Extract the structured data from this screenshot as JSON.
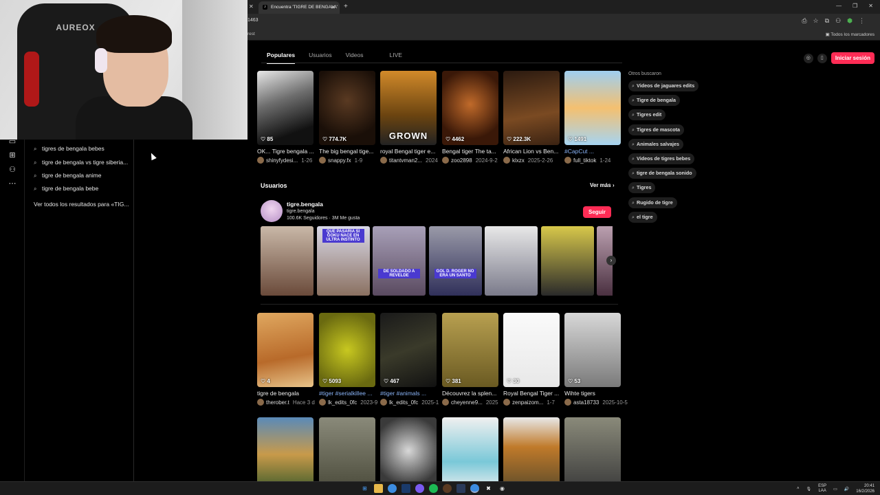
{
  "webcam": {
    "chair_logo": "AUREOX"
  },
  "browser": {
    "tab_title": "Encuentra 'TIGRE DE BENGALA'",
    "url": "1463",
    "bookmark_left": "rest",
    "bookmark_right": "Todos los marcadores"
  },
  "suggestions": {
    "items": [
      "tigres de bengala bebes",
      "tigre de bengala vs tigre siberia...",
      "tigre de bengala anime",
      "tigre de bengala bebe"
    ],
    "see_all": "Ver todos los resultados para «TIG..."
  },
  "search_tabs": [
    "Populares",
    "Usuarios",
    "Videos",
    "LIVE"
  ],
  "header": {
    "login": "Iniciar sesión"
  },
  "row1": [
    {
      "likes": "85",
      "title": "OK... Tigre bengala ...",
      "user": "shinyfydesi...",
      "date": "1-26",
      "blue": false,
      "bg": "linear-gradient(160deg,#e8e8e8,#6d6d6d 40%,#111 80%)"
    },
    {
      "likes": "774.7K",
      "title": "The big bengal tige...",
      "user": "snappy.fx",
      "date": "1-9",
      "blue": false,
      "bg": "radial-gradient(circle at 50% 40%,#5a3a22,#1a0f08 70%)"
    },
    {
      "likes": "",
      "title": "royal Bengal tiger e...",
      "user": "titantvman2...",
      "date": "2024",
      "blue": false,
      "bg": "linear-gradient(180deg,#d28a2a,#6b4410 60%,#222 100%)",
      "overlay": "GROWN"
    },
    {
      "likes": "4462",
      "title": "Bengal tiger The ta...",
      "user": "zoo2898",
      "date": "2024-9-2",
      "blue": false,
      "bg": "radial-gradient(circle at 50% 45%,#c06a2a,#3a1808 70%)"
    },
    {
      "likes": "222.3K",
      "title": "African Lion vs Ben...",
      "user": "klxzx",
      "date": "2025-2-26",
      "blue": false,
      "bg": "linear-gradient(170deg,#2b1a10,#7a4a22 60%,#3a2212)"
    },
    {
      "likes": "1491",
      "title": "#CapCut ...",
      "user": "full_tiktok",
      "date": "1-24",
      "blue": true,
      "bg": "linear-gradient(180deg,#9fcff0,#f4c070 50%,#a6d4f2)"
    }
  ],
  "users_section": {
    "title": "Usuarios",
    "see_more": "Ver más"
  },
  "user": {
    "name": "tigre.bengala",
    "handle": "tigre.bengala",
    "followers": "100.6K",
    "followers_label": "Seguidores",
    "likes": "3M",
    "likes_label": "Me gusta",
    "follow": "Seguir"
  },
  "user_thumbs": [
    {
      "caption": "",
      "bg": "linear-gradient(180deg,#c9b8a8,#6a4a3a)"
    },
    {
      "caption": "QUE PASARIA SI GOKU NACE EN ULTRA INSTINTO",
      "bg": "linear-gradient(180deg,#d9d9e8,#8a7060)"
    },
    {
      "caption": "DE SOLDADO A REVELDE",
      "bg": "linear-gradient(180deg,#a8a0b8,#5a4a60)"
    },
    {
      "caption": "GOL D. ROGER NO ERA UN SANTO",
      "bg": "linear-gradient(180deg,#9a9aa8,#30305a)"
    },
    {
      "caption": "",
      "bg": "linear-gradient(180deg,#e8e8e8,#7a7a8a)"
    },
    {
      "caption": "",
      "bg": "linear-gradient(180deg,#d8c84a,#2a2a2a)"
    },
    {
      "caption": "",
      "bg": "linear-gradient(180deg,#bba0b0,#4a3040)"
    }
  ],
  "row2": [
    {
      "likes": "4",
      "title": "tigre de bengala",
      "user": "therober.t",
      "date": "Hace 3 d",
      "blue": false,
      "bg": "linear-gradient(170deg,#e0a860,#b86a2a 60%,#e8c48a)"
    },
    {
      "likes": "5093",
      "title": "#tiger #serialkillee ...",
      "user": "lk_edits_0fc",
      "date": "2023-9",
      "blue": true,
      "bg": "radial-gradient(circle at 50% 50%,#c8c820,#6a6a10 80%)"
    },
    {
      "likes": "467",
      "title": "#tiger #animals ...",
      "user": "lk_edits_0fc",
      "date": "2025-1",
      "blue": true,
      "bg": "linear-gradient(160deg,#1a1a1a,#3a3a2a 50%,#111)"
    },
    {
      "likes": "381",
      "title": "Découvrez la splen...",
      "user": "cheyenne9...",
      "date": "2025",
      "blue": false,
      "bg": "linear-gradient(180deg,#b8a050,#6a5a22)"
    },
    {
      "likes": "30",
      "title": "Royal Bengal Tiger ...",
      "user": "zenpaizom...",
      "date": "1-7",
      "blue": false,
      "bg": "linear-gradient(180deg,#fafafa,#e8e8e8)"
    },
    {
      "likes": "53",
      "title": "Wihte tigers",
      "user": "asta18733",
      "date": "2025-10-5",
      "blue": false,
      "bg": "linear-gradient(180deg,#d8d8d8,#7a7a7a)"
    }
  ],
  "row3": [
    {
      "bg": "linear-gradient(180deg,#5a8ab8,#c89a4a 50%,#3a5a2a)"
    },
    {
      "bg": "linear-gradient(180deg,#8a8a7a,#4a4a3a)"
    },
    {
      "bg": "radial-gradient(circle at 50% 45%,#d8d8d8,#3a3a3a 70%)"
    },
    {
      "bg": "linear-gradient(180deg,#f0f0f0,#7ac8d8 60%,#f0f0f0)"
    },
    {
      "bg": "linear-gradient(180deg,#e8e8e8,#c07a2a 40%,#5a4a2a)"
    },
    {
      "bg": "linear-gradient(180deg,#8a8a7a,#3a3a3a)"
    }
  ],
  "others": {
    "title": "Otros buscaron",
    "chips": [
      "Videos de jaguares edits",
      "Tigre de bengala",
      "Tigres edit",
      "Tigres de mascota",
      "Animales salvajes",
      "Videos de tigres bebes",
      "tigre de bengala sonido",
      "Tigres",
      "Rugido de tigre",
      "el tigre"
    ]
  },
  "taskbar": {
    "lang": "ESP",
    "lang2": "LAA",
    "time": "20:41",
    "date": "16/2/2026"
  }
}
